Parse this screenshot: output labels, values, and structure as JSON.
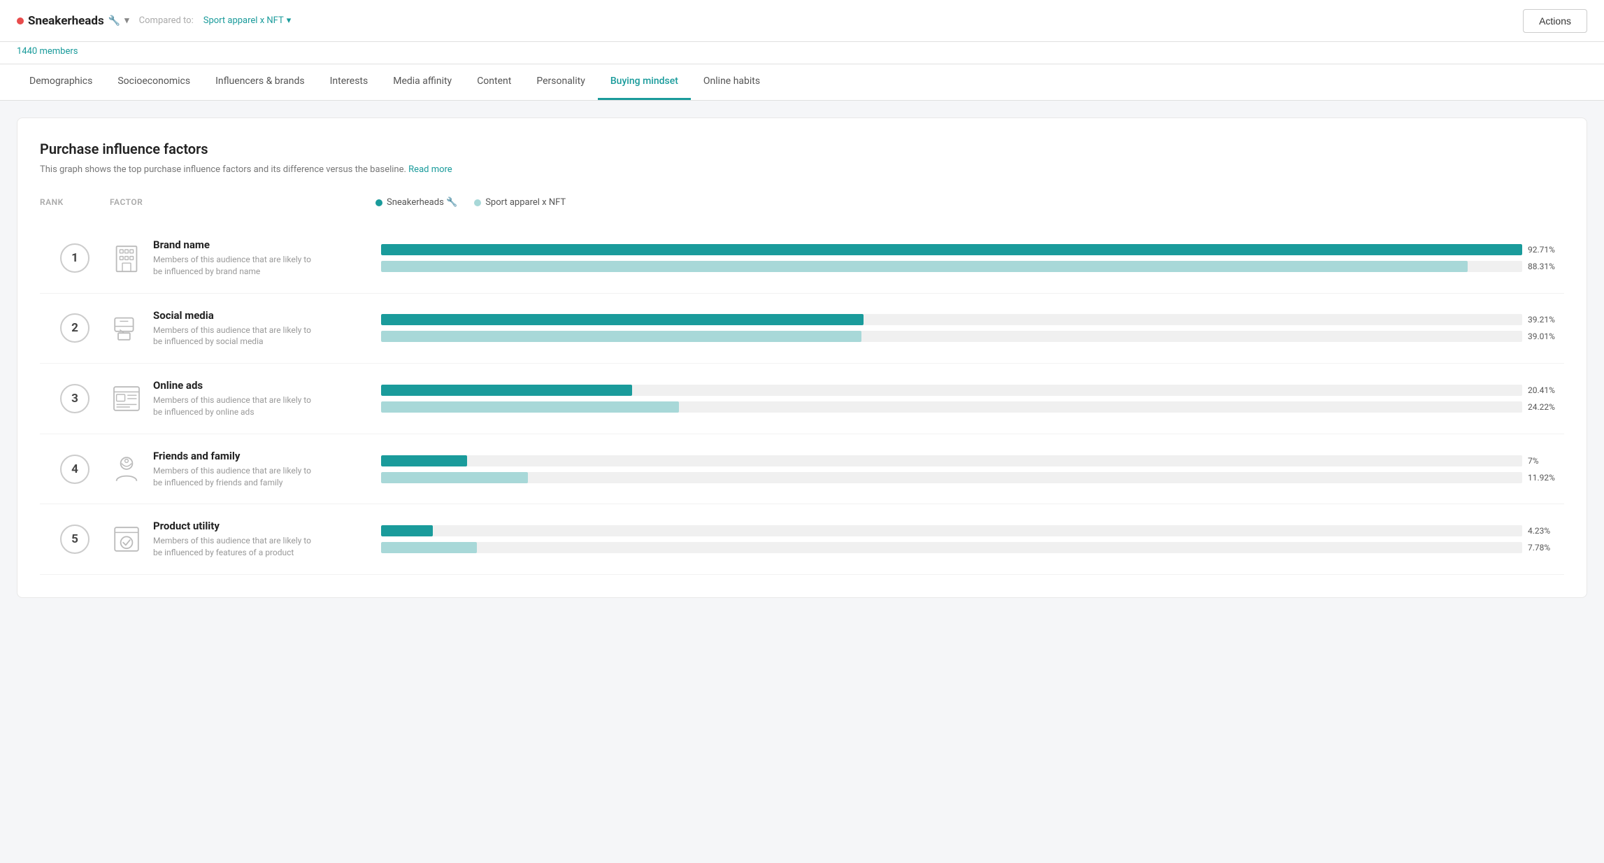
{
  "header": {
    "audience_dot_color": "#e84c4c",
    "audience_name": "Sneakerheads",
    "audience_icon": "🔧",
    "chevron": "▾",
    "compared_label": "Compared to:",
    "compared_link": "Sport apparel x NFT",
    "compared_chevron": "▾",
    "members": "1440 members",
    "actions_label": "Actions"
  },
  "nav": {
    "tabs": [
      {
        "id": "demographics",
        "label": "Demographics",
        "active": false
      },
      {
        "id": "socioeconomics",
        "label": "Socioeconomics",
        "active": false
      },
      {
        "id": "influencers",
        "label": "Influencers & brands",
        "active": false
      },
      {
        "id": "interests",
        "label": "Interests",
        "active": false
      },
      {
        "id": "media-affinity",
        "label": "Media affinity",
        "active": false
      },
      {
        "id": "content",
        "label": "Content",
        "active": false
      },
      {
        "id": "personality",
        "label": "Personality",
        "active": false
      },
      {
        "id": "buying-mindset",
        "label": "Buying mindset",
        "active": true
      },
      {
        "id": "online-habits",
        "label": "Online habits",
        "active": false
      }
    ]
  },
  "main": {
    "card_title": "Purchase influence factors",
    "card_subtitle": "This graph shows the top purchase influence factors and its difference versus the baseline.",
    "read_more": "Read more",
    "columns": {
      "rank": "Rank",
      "factor": "Factor"
    },
    "legend": {
      "primary_label": "Sneakerheads 🔧",
      "secondary_label": "Sport apparel x NFT"
    },
    "max_bar_width": 100,
    "factors": [
      {
        "rank": "1",
        "name": "Brand name",
        "description": "Members of this audience that are likely to be influenced by brand name",
        "icon_type": "building",
        "primary_value": 92.71,
        "secondary_value": 88.31,
        "primary_label": "92.71%",
        "secondary_label": "88.31%"
      },
      {
        "rank": "2",
        "name": "Social media",
        "description": "Members of this audience that are likely to be influenced by social media",
        "icon_type": "social",
        "primary_value": 39.21,
        "secondary_value": 39.01,
        "primary_label": "39.21%",
        "secondary_label": "39.01%"
      },
      {
        "rank": "3",
        "name": "Online ads",
        "description": "Members of this audience that are likely to be influenced by online ads",
        "icon_type": "ads",
        "primary_value": 20.41,
        "secondary_value": 24.22,
        "primary_label": "20.41%",
        "secondary_label": "24.22%"
      },
      {
        "rank": "4",
        "name": "Friends and family",
        "description": "Members of this audience that are likely to be influenced by friends and family",
        "icon_type": "friends",
        "primary_value": 7.0,
        "secondary_value": 11.92,
        "primary_label": "7%",
        "secondary_label": "11.92%"
      },
      {
        "rank": "5",
        "name": "Product utility",
        "description": "Members of this audience that are likely to be influenced by features of a product",
        "icon_type": "product",
        "primary_value": 4.23,
        "secondary_value": 7.78,
        "primary_label": "4.23%",
        "secondary_label": "7.78%"
      }
    ]
  }
}
